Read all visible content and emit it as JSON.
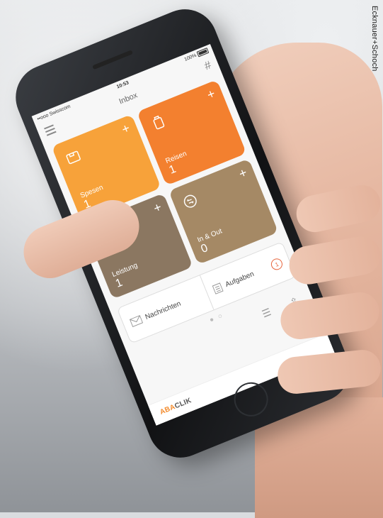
{
  "credit": "Ecknauer+Schoch",
  "status_bar": {
    "carrier": "••ooo Swisscom",
    "time": "10:53",
    "battery": "100%"
  },
  "nav": {
    "title": "Inbox"
  },
  "tiles": [
    {
      "label": "Spesen",
      "count": "1",
      "color": "#f7a23a",
      "icon": "wallet-icon"
    },
    {
      "label": "Reisen",
      "count": "1",
      "color": "#f3802f",
      "icon": "luggage-icon"
    },
    {
      "label": "Leistung",
      "count": "1",
      "color": "#8b7761",
      "icon": "gauge-icon"
    },
    {
      "label": "In & Out",
      "count": "0",
      "color": "#a58965",
      "icon": "in-out-icon"
    }
  ],
  "panel": {
    "messages_label": "Nachrichten",
    "tasks_label": "Aufgaben",
    "tasks_badge": "1"
  },
  "brand": {
    "part_a": "ABA",
    "part_b": "CLIK"
  },
  "colors": {
    "accent": "#e8643c",
    "brand_orange": "#f28a2c"
  }
}
